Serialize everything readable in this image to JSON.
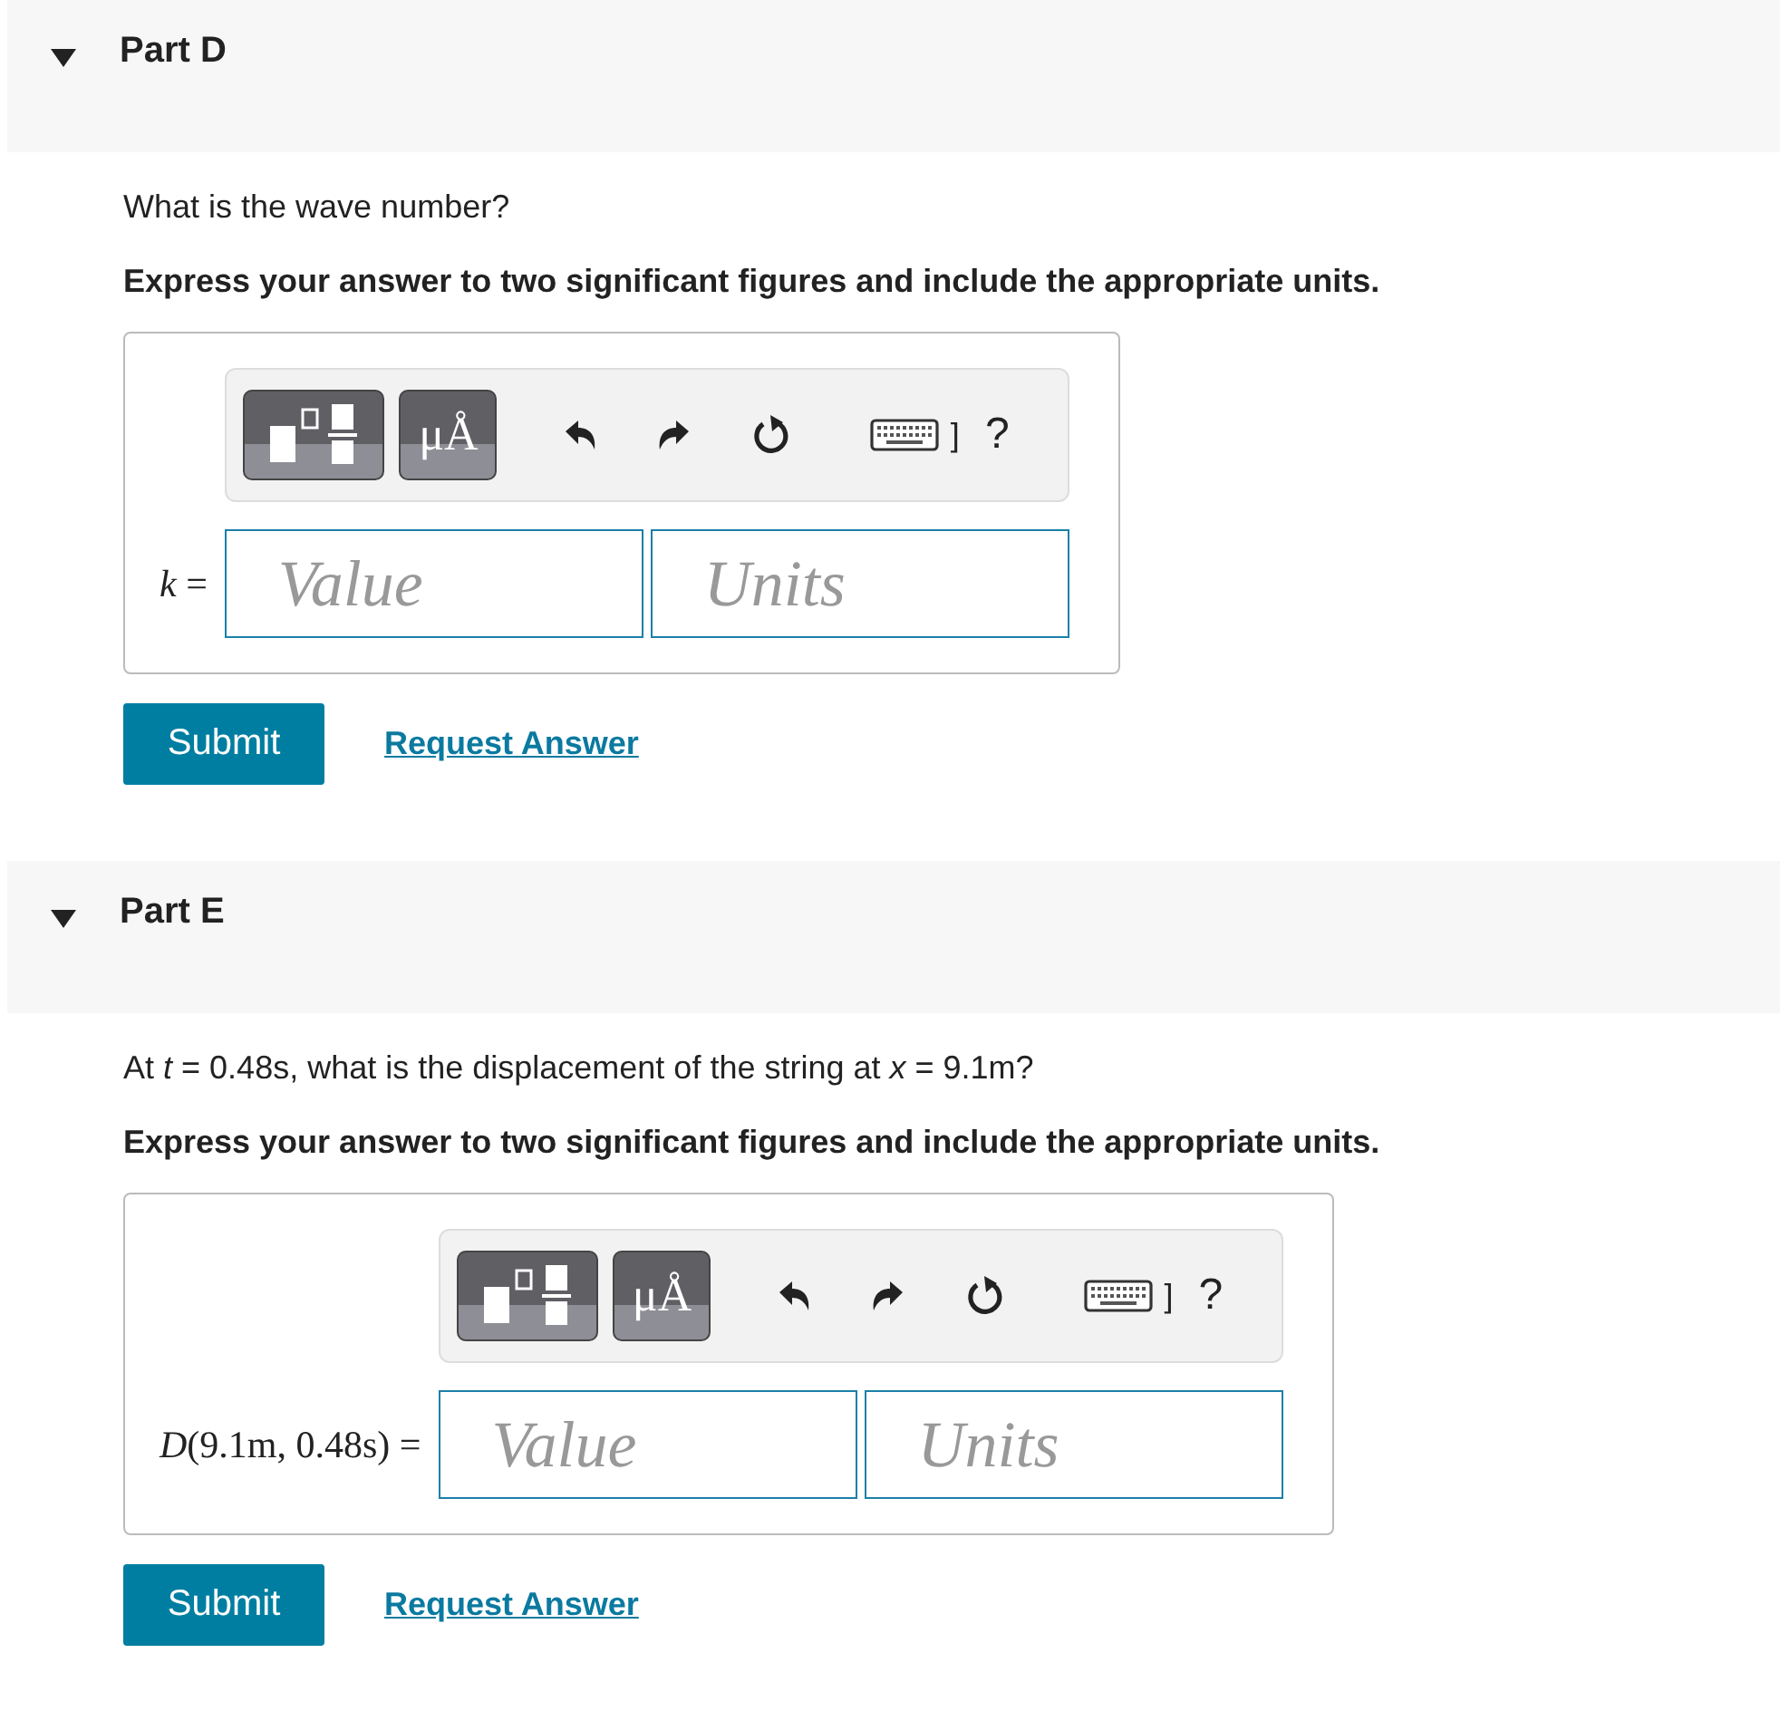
{
  "parts": [
    {
      "title": "Part D",
      "expanded": true,
      "question": "What is the wave number?",
      "instruction": "Express your answer to two significant figures and include the appropriate units.",
      "answer": {
        "label": "*k* =",
        "toolbar": {
          "symbols": "μÅ",
          "keyboard_bracket": "]",
          "help": "?"
        },
        "value_placeholder": "Value",
        "units_placeholder": "Units"
      },
      "submit": "Submit",
      "request": "Request Answer"
    },
    {
      "title": "Part E",
      "expanded": true,
      "question": "At *t* = 0.48s, what is the displacement of the string at *x* = 9.1m?",
      "instruction": "Express your answer to two significant figures and include the appropriate units.",
      "answer": {
        "label": "*D*(9.1m, 0.48s) =",
        "toolbar": {
          "symbols": "μÅ",
          "keyboard_bracket": "]",
          "help": "?"
        },
        "value_placeholder": "Value",
        "units_placeholder": "Units"
      },
      "submit": "Submit",
      "request": "Request Answer"
    }
  ]
}
